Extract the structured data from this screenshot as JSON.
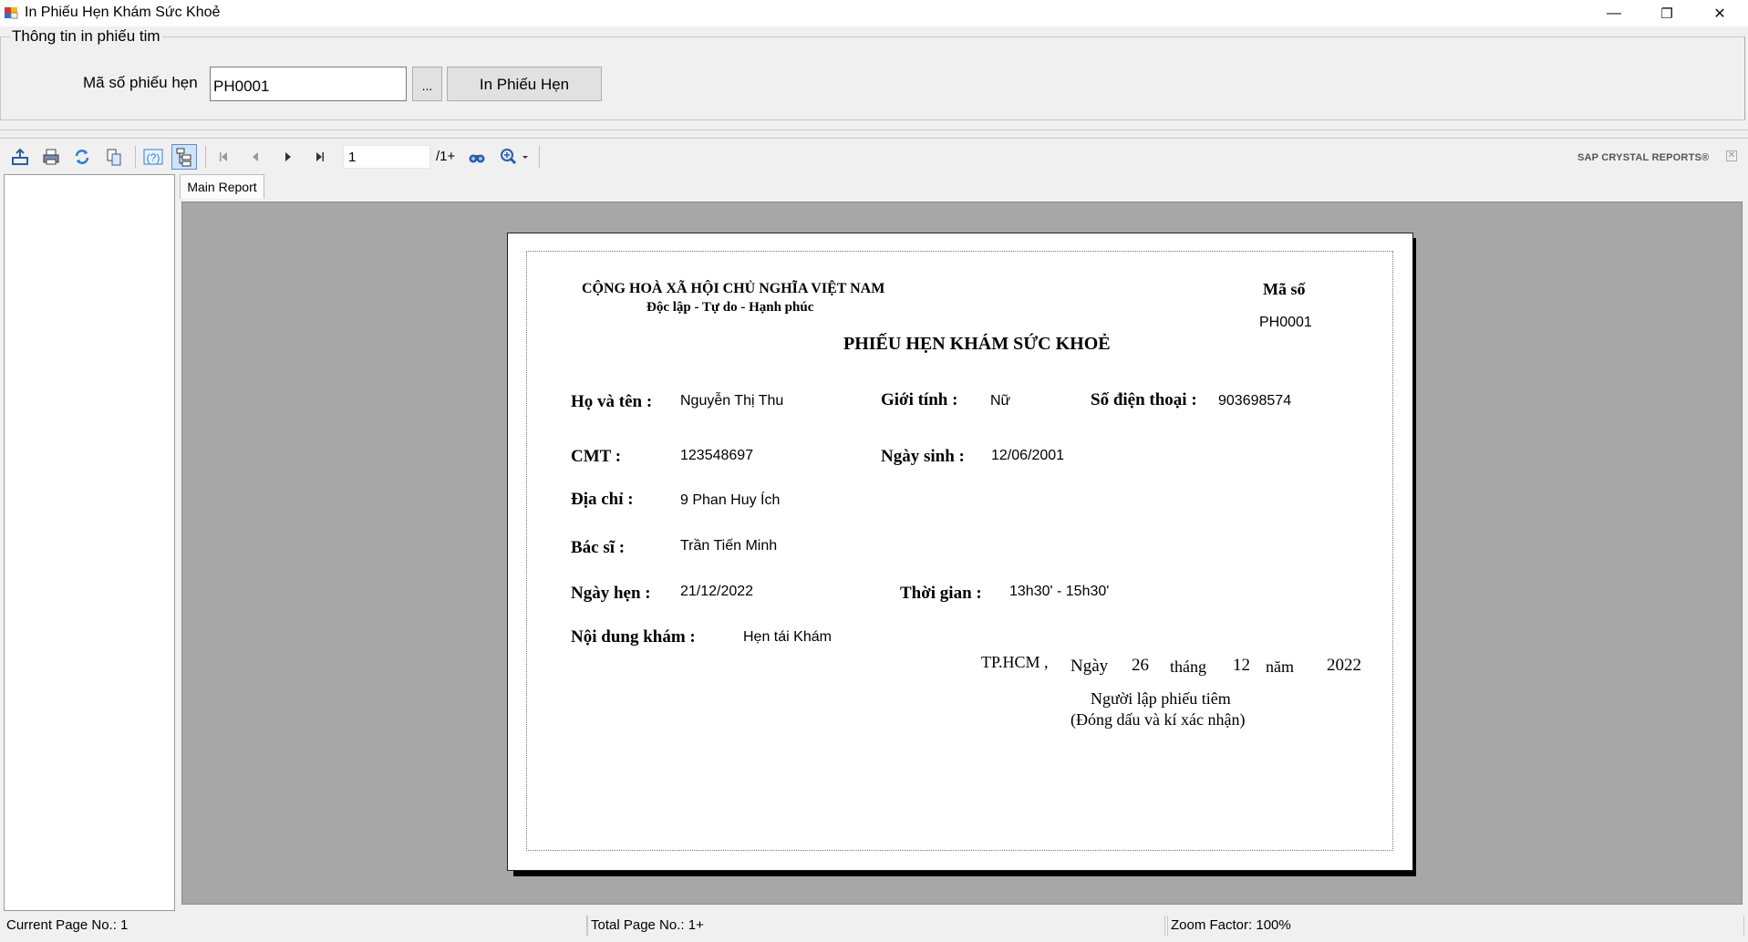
{
  "window": {
    "title": "In Phiếu Hẹn Khám Sức Khoẻ",
    "minimize_glyph": "—",
    "restore_glyph": "❐",
    "close_glyph": "✕"
  },
  "form": {
    "group_title": "Thông tin in phiếu tim",
    "maso_label": "Mã số phiếu hẹn",
    "maso_value": "PH0001",
    "browse_label": "...",
    "print_label": "In Phiếu Hẹn"
  },
  "viewer": {
    "current_page": "1",
    "total_pages": "/1+",
    "brand": "SAP CRYSTAL REPORTS®",
    "tab_label": "Main Report",
    "icons": [
      "export-icon",
      "print-icon",
      "refresh-icon",
      "copy-icon",
      "help-icon",
      "group-tree-icon",
      "first-page-icon",
      "prev-page-icon",
      "next-page-icon",
      "last-page-icon",
      "find-icon",
      "zoom-icon"
    ]
  },
  "report": {
    "nation": "CỘNG HOÀ XÃ HỘI CHỦ NGHĨA VIỆT NAM",
    "motto": "Độc lập - Tự do - Hạnh phúc",
    "maso_label": "Mã số",
    "maso_value": "PH0001",
    "title": "PHIẾU HẸN KHÁM SỨC KHOẺ",
    "hoten_label": "Họ và tên :",
    "hoten_value": "Nguyễn Thị Thu",
    "gioitinh_label": "Giới tính :",
    "gioitinh_value": "Nữ",
    "sdt_label": "Số điện thoại :",
    "sdt_value": "903698574",
    "cmt_label": "CMT :",
    "cmt_value": "123548697",
    "ngaysinh_label": "Ngày sinh :",
    "ngaysinh_value": "12/06/2001",
    "diachi_label": "Địa chỉ :",
    "diachi_value": "9 Phan Huy Ích",
    "bacsi_label": "Bác sĩ :",
    "bacsi_value": "Trần Tiến Minh",
    "ngayhen_label": "Ngày hẹn :",
    "ngayhen_value": "21/12/2022",
    "thoigian_label": "Thời gian :",
    "thoigian_value": "13h30' - 15h30'",
    "noidung_label": "Nội dung khám :",
    "noidung_value": "Hẹn tái Khám",
    "place": "TP.HCM ,",
    "ngay_word": "Ngày",
    "ngay_value": "26",
    "thang_word": "tháng",
    "thang_value": "12",
    "nam_word": "năm",
    "nam_value": "2022",
    "signer": "Người lập phiếu tiêm",
    "signer_note": "(Đóng dấu và kí xác nhận)"
  },
  "status": {
    "current": "Current Page No.: 1",
    "total": "Total Page No.: 1+",
    "zoom": "Zoom Factor: 100%"
  }
}
